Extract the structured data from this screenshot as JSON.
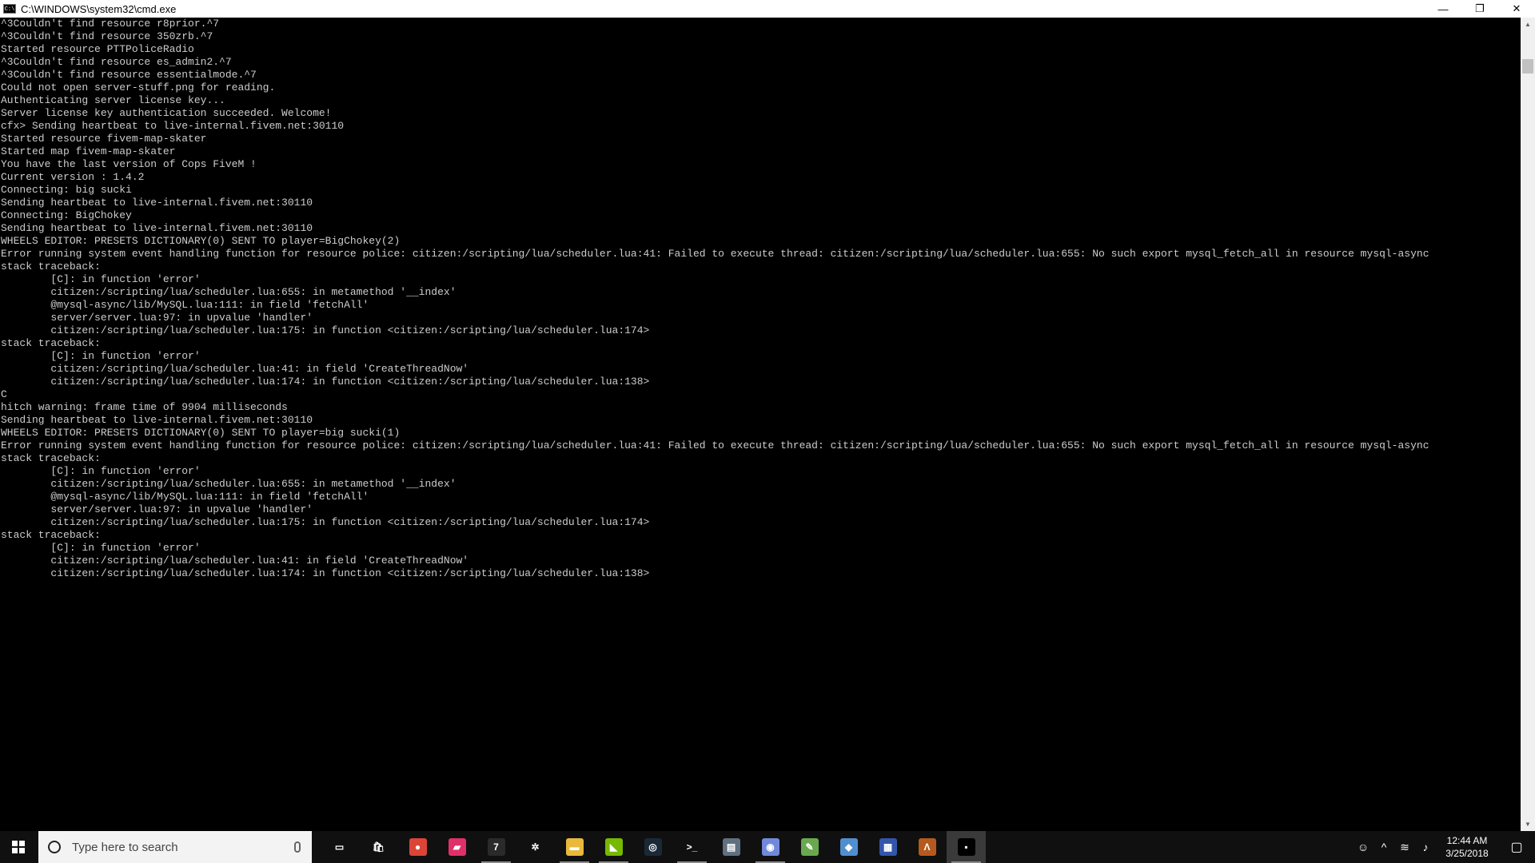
{
  "window": {
    "title": "C:\\WINDOWS\\system32\\cmd.exe",
    "icon_text": "C:\\",
    "controls": {
      "minimize": "—",
      "restore": "❐",
      "close": "✕"
    }
  },
  "console": {
    "lines": [
      "^3Couldn't find resource r8prior.^7",
      "^3Couldn't find resource 350zrb.^7",
      "Started resource PTTPoliceRadio",
      "^3Couldn't find resource es_admin2.^7",
      "^3Couldn't find resource essentialmode.^7",
      "Could not open server-stuff.png for reading.",
      "Authenticating server license key...",
      "Server license key authentication succeeded. Welcome!",
      "cfx> Sending heartbeat to live-internal.fivem.net:30110",
      "Started resource fivem-map-skater",
      "Started map fivem-map-skater",
      "You have the last version of Cops FiveM !",
      "Current version : 1.4.2",
      "Connecting: big sucki",
      "Sending heartbeat to live-internal.fivem.net:30110",
      "Connecting: BigChokey",
      "Sending heartbeat to live-internal.fivem.net:30110",
      "WHEELS EDITOR: PRESETS DICTIONARY(0) SENT TO player=BigChokey(2)",
      "Error running system event handling function for resource police: citizen:/scripting/lua/scheduler.lua:41: Failed to execute thread: citizen:/scripting/lua/scheduler.lua:655: No such export mysql_fetch_all in resource mysql-async",
      "stack traceback:",
      "        [C]: in function 'error'",
      "        citizen:/scripting/lua/scheduler.lua:655: in metamethod '__index'",
      "        @mysql-async/lib/MySQL.lua:111: in field 'fetchAll'",
      "        server/server.lua:97: in upvalue 'handler'",
      "        citizen:/scripting/lua/scheduler.lua:175: in function <citizen:/scripting/lua/scheduler.lua:174>",
      "stack traceback:",
      "        [C]: in function 'error'",
      "        citizen:/scripting/lua/scheduler.lua:41: in field 'CreateThreadNow'",
      "        citizen:/scripting/lua/scheduler.lua:174: in function <citizen:/scripting/lua/scheduler.lua:138>",
      "C",
      "hitch warning: frame time of 9904 milliseconds",
      "Sending heartbeat to live-internal.fivem.net:30110",
      "WHEELS EDITOR: PRESETS DICTIONARY(0) SENT TO player=big sucki(1)",
      "Error running system event handling function for resource police: citizen:/scripting/lua/scheduler.lua:41: Failed to execute thread: citizen:/scripting/lua/scheduler.lua:655: No such export mysql_fetch_all in resource mysql-async",
      "stack traceback:",
      "        [C]: in function 'error'",
      "        citizen:/scripting/lua/scheduler.lua:655: in metamethod '__index'",
      "        @mysql-async/lib/MySQL.lua:111: in field 'fetchAll'",
      "        server/server.lua:97: in upvalue 'handler'",
      "        citizen:/scripting/lua/scheduler.lua:175: in function <citizen:/scripting/lua/scheduler.lua:174>",
      "stack traceback:",
      "        [C]: in function 'error'",
      "        citizen:/scripting/lua/scheduler.lua:41: in field 'CreateThreadNow'",
      "        citizen:/scripting/lua/scheduler.lua:174: in function <citizen:/scripting/lua/scheduler.lua:138>"
    ]
  },
  "taskbar": {
    "search_placeholder": "Type here to search",
    "apps": [
      {
        "name": "task-view-icon",
        "glyph": "▭",
        "color": "#101010"
      },
      {
        "name": "store-icon",
        "glyph": "🛍",
        "color": "#101010"
      },
      {
        "name": "chrome-icon",
        "glyph": "●",
        "color": "#db4437"
      },
      {
        "name": "app-pink-icon",
        "glyph": "▰",
        "color": "#e0306a"
      },
      {
        "name": "app-seven-icon",
        "glyph": "7",
        "color": "#2a2a2a"
      },
      {
        "name": "app-gear-icon",
        "glyph": "✲",
        "color": "#101010"
      },
      {
        "name": "file-explorer-icon",
        "glyph": "▬",
        "color": "#e8b93a"
      },
      {
        "name": "nvidia-icon",
        "glyph": "◣",
        "color": "#76b900"
      },
      {
        "name": "steam-icon",
        "glyph": "◎",
        "color": "#1b2838"
      },
      {
        "name": "terminal-icon",
        "glyph": ">_",
        "color": "#101010"
      },
      {
        "name": "app-window-icon",
        "glyph": "▤",
        "color": "#607080"
      },
      {
        "name": "discord-icon",
        "glyph": "◉",
        "color": "#7289da"
      },
      {
        "name": "notepad-icon",
        "glyph": "✎",
        "color": "#6aa84f"
      },
      {
        "name": "app-blue-icon",
        "glyph": "◆",
        "color": "#4f8fd0"
      },
      {
        "name": "app-flag-icon",
        "glyph": "▦",
        "color": "#3355aa"
      },
      {
        "name": "app-a-icon",
        "glyph": "Λ",
        "color": "#b45a1e"
      },
      {
        "name": "cmd-icon",
        "glyph": "▪",
        "color": "#000000",
        "active": true
      }
    ],
    "tray": {
      "people": "☺",
      "chevron": "^",
      "network": "≋",
      "volume": "♪",
      "time": "12:44 AM",
      "date": "3/25/2018",
      "notifications": "▢"
    }
  }
}
